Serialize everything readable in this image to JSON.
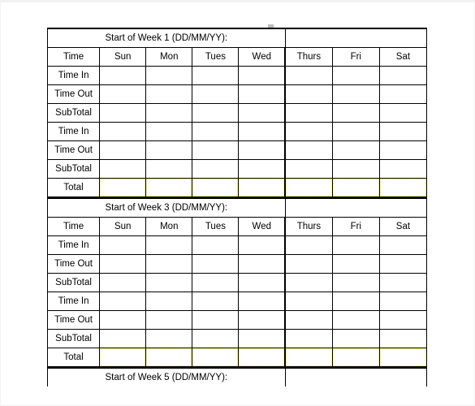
{
  "document": {
    "type": "timesheet",
    "columns": [
      "Time",
      "Sun",
      "Mon",
      "Tues",
      "Wed",
      "Thurs",
      "Fri",
      "Sat"
    ],
    "row_labels": [
      "Time In",
      "Time Out",
      "SubTotal",
      "Time In",
      "Time Out",
      "SubTotal"
    ],
    "total_label": "Total",
    "date_field_value": "",
    "weeks": [
      {
        "title": "Start of Week 1 (DD/MM/YY):",
        "date_value": ""
      },
      {
        "title": "Start of Week 3 (DD/MM/YY):",
        "date_value": ""
      },
      {
        "title": "Start of Week 5 (DD/MM/YY):",
        "date_value": ""
      }
    ],
    "cell_values": {
      "week1": {
        "Time In 1": [
          "",
          "",
          "",
          "",
          "",
          "",
          ""
        ],
        "Time Out 1": [
          "",
          "",
          "",
          "",
          "",
          "",
          ""
        ],
        "SubTotal 1": [
          "",
          "",
          "",
          "",
          "",
          "",
          ""
        ],
        "Time In 2": [
          "",
          "",
          "",
          "",
          "",
          "",
          ""
        ],
        "Time Out 2": [
          "",
          "",
          "",
          "",
          "",
          "",
          ""
        ],
        "SubTotal 2": [
          "",
          "",
          "",
          "",
          "",
          "",
          ""
        ],
        "Total": [
          "",
          "",
          "",
          "",
          "",
          "",
          ""
        ]
      },
      "week3": {
        "Time In 1": [
          "",
          "",
          "",
          "",
          "",
          "",
          ""
        ],
        "Time Out 1": [
          "",
          "",
          "",
          "",
          "",
          "",
          ""
        ],
        "SubTotal 1": [
          "",
          "",
          "",
          "",
          "",
          "",
          ""
        ],
        "Time In 2": [
          "",
          "",
          "",
          "",
          "",
          "",
          ""
        ],
        "Time Out 2": [
          "",
          "",
          "",
          "",
          "",
          "",
          ""
        ],
        "SubTotal 2": [
          "",
          "",
          "",
          "",
          "",
          "",
          ""
        ],
        "Total": [
          "",
          "",
          "",
          "",
          "",
          "",
          ""
        ]
      }
    }
  },
  "colors": {
    "week_header_blue": "#92c5ed",
    "input_cell_fill": "#eef0fa",
    "total_cell_fill": "#f1f1c2",
    "total_cell_inner": "#ffff99",
    "grid_line": "#000000",
    "page_background": "#ffffff"
  }
}
